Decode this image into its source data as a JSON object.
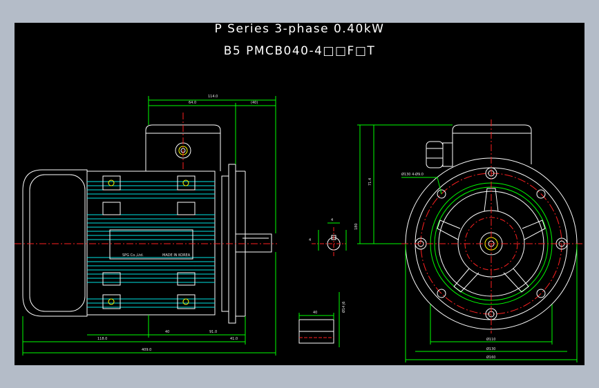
{
  "drawing": {
    "title_line1": "P Series 3-phase 0.40kW",
    "title_line2": "B5 PMCB040-4□□F□T",
    "nameplate_text": "SPG Co.,Ltd.",
    "nameplate_sub": "MADE IN KOREA",
    "dimensions_side": {
      "overall_top": "114.0",
      "inner_top": "64.0",
      "shaft_top": "(40)",
      "bottom_left": "118.0",
      "bottom_mid": "40",
      "bottom_right": "91.0",
      "bottom_right2": "41.0",
      "overall_bottom": "409.0"
    },
    "dimensions_front": {
      "height_1": "71.4",
      "height_2": "180",
      "bolt_circle": "Ø130 4-Ø9.0",
      "dia_1": "Ø110",
      "dia_2": "Ø130",
      "dia_3": "Ø160"
    },
    "dimensions_shaft": {
      "key_dim": "4",
      "shaft_dia": "Ø14 j6",
      "shaft_len": "40",
      "depth": "4"
    },
    "colors": {
      "background": "#000000",
      "outline": "#ffffff",
      "fins": "#00e5e5",
      "dimension": "#00ff00",
      "centerline": "#ff2020",
      "accent": "#ffff00"
    }
  }
}
